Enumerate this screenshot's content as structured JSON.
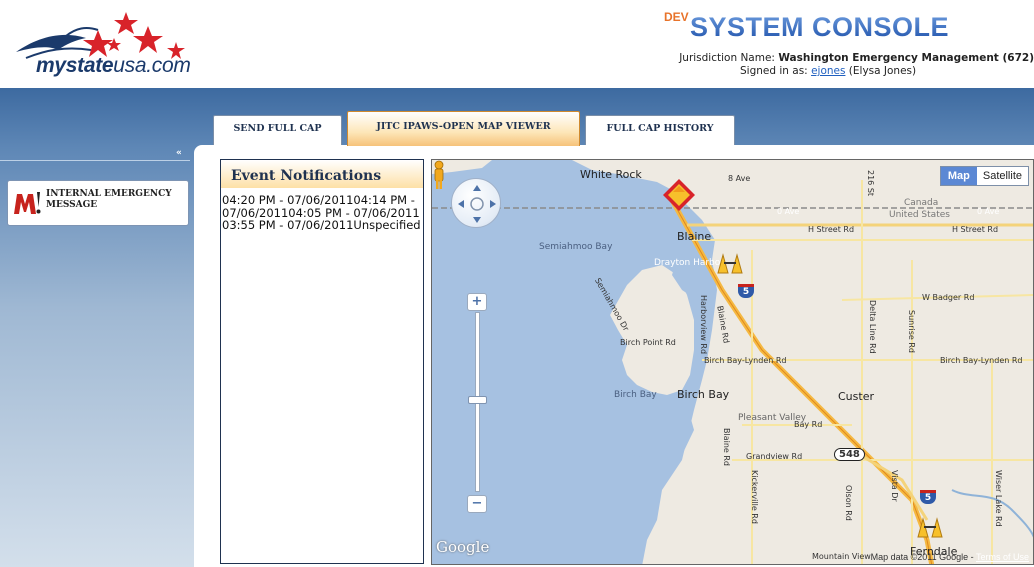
{
  "header": {
    "logo_text_bold": "mystate",
    "logo_text_rest": "usa.com",
    "console_prefix": "DEV",
    "console_title": "SYSTEM CONSOLE",
    "jurisdiction_label": "Jurisdiction Name:",
    "jurisdiction_value": "Washington Emergency Management (672)",
    "signed_in_label": "Signed in as:",
    "signed_in_user": "ejones",
    "signed_in_name": "(Elysa Jones)"
  },
  "sidebar": {
    "collapse_glyph": "«",
    "items": [
      {
        "label": "INTERNAL EMERGENCY MESSAGE",
        "icon": "m-alert-icon"
      }
    ]
  },
  "tabs": [
    {
      "label": "SEND FULL CAP",
      "active": false
    },
    {
      "label": "JITC IPAWS-OPEN MAP VIEWER",
      "active": true
    },
    {
      "label": "FULL CAP HISTORY",
      "active": false
    }
  ],
  "events": {
    "title": "Event Notifications",
    "text": "04:20 PM - 07/06/201104:14 PM - 07/06/201104:05 PM - 07/06/201103:55 PM - 07/06/2011Unspecified"
  },
  "map": {
    "type_buttons": {
      "map": "Map",
      "satellite": "Satellite",
      "selected": "Map"
    },
    "labels": {
      "white_rock": "White Rock",
      "ave8": "8 Ave",
      "st216": "216 St",
      "canada": "Canada",
      "united_states": "United States",
      "ave0a": "0 Ave",
      "ave0b": "0 Ave",
      "blaine": "Blaine",
      "h_street_1": "H Street Rd",
      "h_street_2": "H Street Rd",
      "semiahmoo_bay": "Semiahmoo Bay",
      "drayton_harbor": "Drayton Harbor",
      "semiahmoo_dr": "Semiahmoo Dr",
      "harborview_rd": "Harborview Rd",
      "blaine_rd_1": "Blaine Rd",
      "birch_point_rd": "Birch Point Rd",
      "birch_bay_lynden_1": "Birch Bay-Lynden Rd",
      "birch_bay_lynden_2": "Birch Bay-Lynden Rd",
      "birch_bay_water": "Birch Bay",
      "birch_bay_town": "Birch Bay",
      "custer": "Custer",
      "pleasant_valley": "Pleasant Valley",
      "bay_rd": "Bay Rd",
      "blaine_rd_2": "Blaine Rd",
      "grandview_rd": "Grandview Rd",
      "route_548": "548",
      "kickerville_rd": "Kickerville Rd",
      "olson_rd": "Olson Rd",
      "vista_dr": "Vista Dr",
      "w_badger_rd": "W Badger Rd",
      "delta_line_rd": "Delta Line Rd",
      "sunrise_rd": "Sunrise Rd",
      "wiser_lake_rd": "Wiser Lake Rd",
      "ferndale": "Ferndale",
      "interstate_5": "5",
      "mountain_view": "Mountain View"
    },
    "google_logo": "Google",
    "map_data": "Map data ©2011 Google",
    "terms": "Terms of Use",
    "zoom_in": "+",
    "zoom_out": "−",
    "zoom_level_fraction": 0.45
  },
  "colors": {
    "band_top": "#3d6aa0",
    "active_tab": "#f6c27a",
    "map_water": "#a6c1e1",
    "map_land": "#eeeae2",
    "freeway": "#f5b942"
  }
}
